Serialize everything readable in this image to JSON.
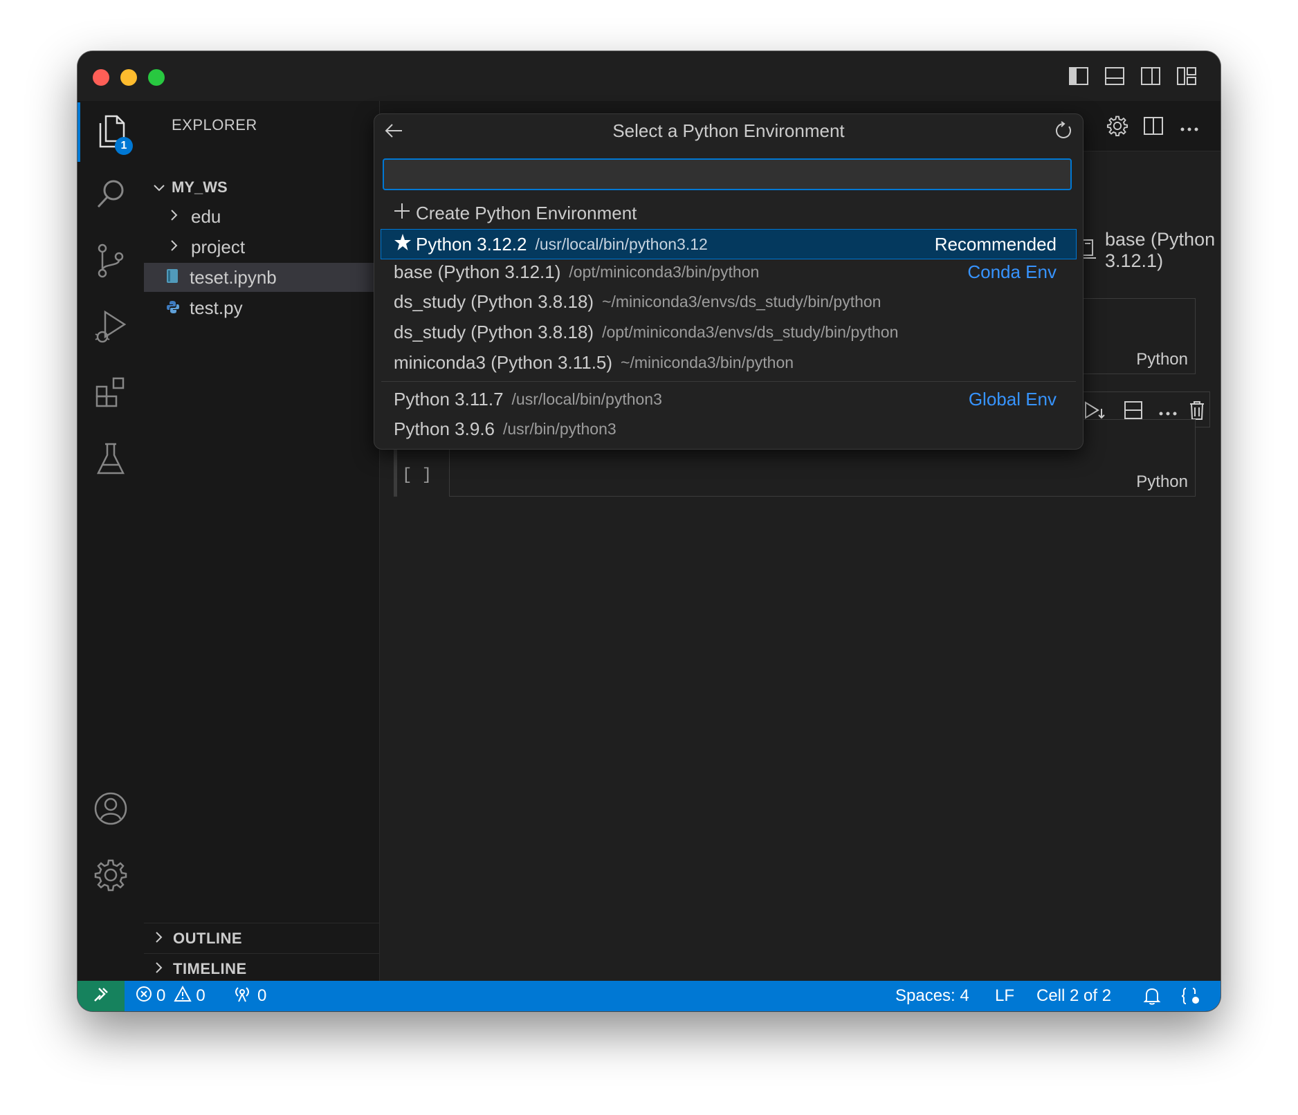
{
  "colors": {
    "accent": "#0078d4",
    "link_blue": "#3794ff",
    "remote_green": "#16825d",
    "selection": "#04395e"
  },
  "activity_bar": {
    "explorer_badge": "1",
    "icons": [
      "files-icon",
      "search-icon",
      "source-control-icon",
      "run-debug-icon",
      "extensions-icon",
      "testing-icon",
      "account-icon",
      "settings-gear-icon"
    ]
  },
  "sidebar": {
    "title": "EXPLORER",
    "workspace": "MY_WS",
    "items": [
      {
        "label": "edu",
        "kind": "folder"
      },
      {
        "label": "project",
        "kind": "folder"
      },
      {
        "label": "teset.ipynb",
        "kind": "notebook"
      },
      {
        "label": "test.py",
        "kind": "python"
      }
    ],
    "sections": [
      "OUTLINE",
      "TIMELINE"
    ]
  },
  "editor": {
    "kernel": "base (Python 3.12.1)",
    "cell1_lang": "Python",
    "cell2_lang": "Python",
    "cell2_exec": "[ ]"
  },
  "quick_pick": {
    "title": "Select a Python Environment",
    "input_value": "",
    "create_label": "Create Python Environment",
    "groups": [
      {
        "items": [
          {
            "label": "Python 3.12.2",
            "path": "/usr/local/bin/python3.12",
            "tag": "Recommended",
            "selected": true,
            "starred": true
          }
        ]
      },
      {
        "items": [
          {
            "label": "base (Python 3.12.1)",
            "path": "/opt/miniconda3/bin/python",
            "tag": "Conda Env"
          },
          {
            "label": "ds_study (Python 3.8.18)",
            "path": "~/miniconda3/envs/ds_study/bin/python",
            "tag": ""
          },
          {
            "label": "ds_study (Python 3.8.18)",
            "path": "/opt/miniconda3/envs/ds_study/bin/python",
            "tag": ""
          },
          {
            "label": "miniconda3 (Python 3.11.5)",
            "path": "~/miniconda3/bin/python",
            "tag": ""
          }
        ]
      },
      {
        "items": [
          {
            "label": "Python 3.11.7",
            "path": "/usr/local/bin/python3",
            "tag": "Global Env"
          },
          {
            "label": "Python 3.9.6",
            "path": "/usr/bin/python3",
            "tag": ""
          }
        ]
      }
    ]
  },
  "status_bar": {
    "errors": "0",
    "warnings": "0",
    "ports": "0",
    "spaces": "Spaces: 4",
    "eol": "LF",
    "cell": "Cell 2 of 2"
  }
}
